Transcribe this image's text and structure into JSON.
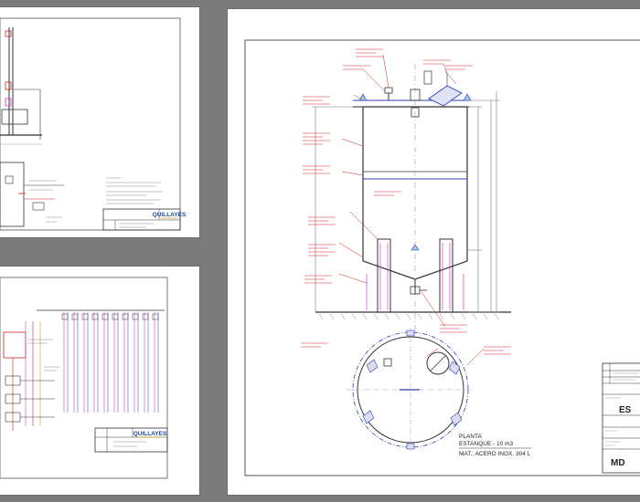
{
  "colors": {
    "background": "#7b7b7b",
    "paper": "#ffffff",
    "line": "#333333",
    "blue": "#2b3fb8",
    "red": "#d22222",
    "magenta": "#d33ad3",
    "dim": "#777777",
    "logo_blue": "#1a4a9e",
    "logo_accent": "#c9a227"
  },
  "sheets": {
    "top_left": {
      "logo_text": "QUILLAYES"
    },
    "bottom_left": {
      "logo_text": "QUILLAYES"
    },
    "main": {
      "plan_caption_line1": "PLANTA",
      "plan_caption_line2": "ESTANQUE - 10 m3",
      "plan_caption_line3": "MAT.: ACERO INOX. 304 L",
      "title_block_large_1": "ES",
      "title_block_large_2": "MD"
    }
  }
}
